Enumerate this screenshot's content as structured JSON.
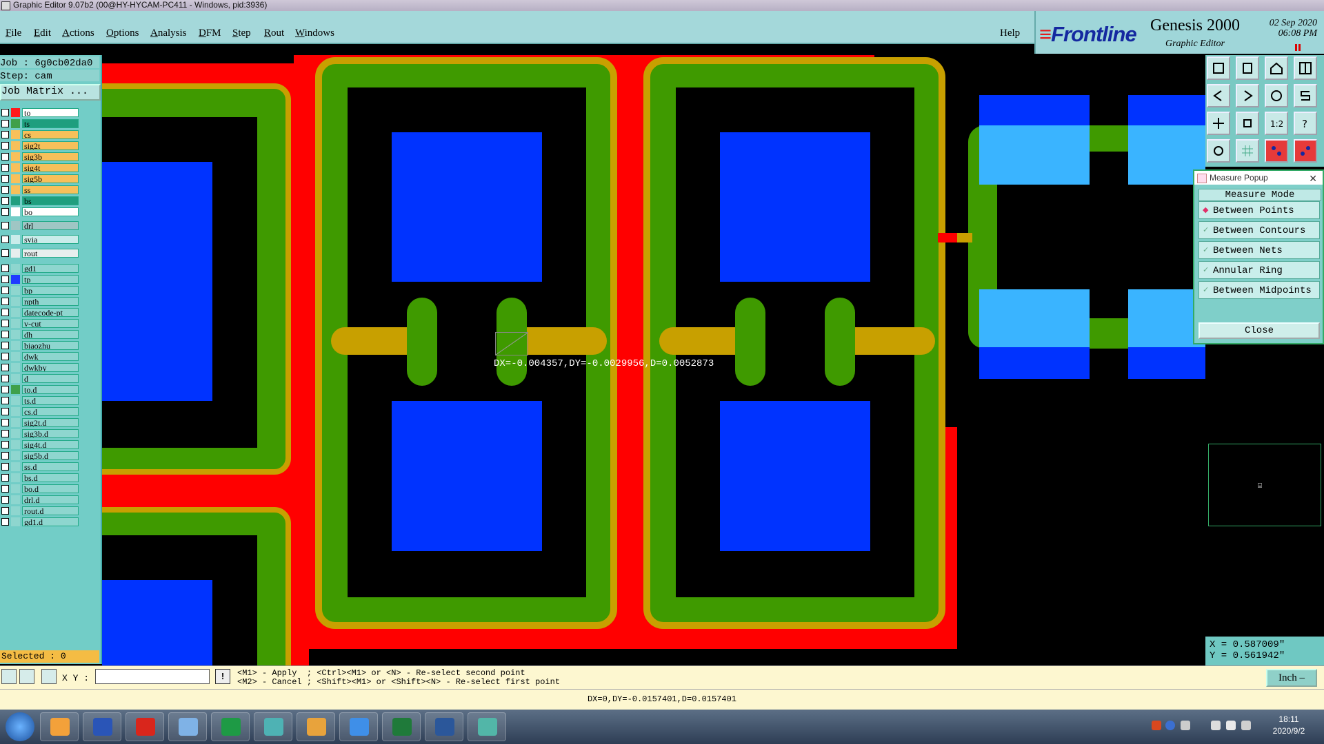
{
  "window": {
    "title": "Graphic Editor 9.07b2 (00@HY-HYCAM-PC411 - Windows, pid:3936)"
  },
  "menu": {
    "items": [
      "File",
      "Edit",
      "Actions",
      "Options",
      "Analysis",
      "DFM",
      "Step",
      "Rout",
      "Windows"
    ],
    "help": "Help"
  },
  "brand": {
    "logo": "Frontline",
    "product": "Genesis 2000",
    "subtitle": "Graphic Editor",
    "date": "02  Sep  2020",
    "time": "06:08  PM"
  },
  "job": {
    "job_label": "Job : 6g0cb02da0",
    "step_label": "Step: cam",
    "matrix_button": "Job Matrix ..."
  },
  "layers": [
    {
      "name": "to",
      "color": "#ff1a1a",
      "bg": "#ffffff"
    },
    {
      "name": "ts",
      "color": "#3fa04a",
      "bg": "#1f9e7e"
    },
    {
      "name": "cs",
      "color": "#f7c05a",
      "bg": "#f7c05a"
    },
    {
      "name": "sig2t",
      "color": "#f7c05a",
      "bg": "#f7c05a"
    },
    {
      "name": "sig3b",
      "color": "#f7c05a",
      "bg": "#f7c05a"
    },
    {
      "name": "sig4t",
      "color": "#f7c05a",
      "bg": "#f7c05a"
    },
    {
      "name": "sig5b",
      "color": "#f7c05a",
      "bg": "#f7c05a"
    },
    {
      "name": "ss",
      "color": "#f7c05a",
      "bg": "#f7c05a"
    },
    {
      "name": "bs",
      "color": "#1f9e7e",
      "bg": "#1f9e7e"
    },
    {
      "name": "bo",
      "color": "#ffffff",
      "bg": "#ffffff"
    },
    {
      "name": "drl",
      "color": "#9fc6c4",
      "bg": "#9fc6c4"
    },
    {
      "name": "svia",
      "color": "#c9ecea",
      "bg": "#c9ecea"
    },
    {
      "name": "rout",
      "color": "#e7eeee",
      "bg": "#e7eeee"
    },
    {
      "name": "gd1",
      "color": "#8ed6cf",
      "bg": "#8ed6cf"
    },
    {
      "name": "tp",
      "color": "#1f3bff",
      "bg": "#8ed6cf"
    },
    {
      "name": "bp",
      "color": "#8ed6cf",
      "bg": "#8ed6cf"
    },
    {
      "name": "npth",
      "color": "#8ed6cf",
      "bg": "#8ed6cf"
    },
    {
      "name": "datecode-pt",
      "color": "#8ed6cf",
      "bg": "#8ed6cf"
    },
    {
      "name": "v-cut",
      "color": "#8ed6cf",
      "bg": "#8ed6cf"
    },
    {
      "name": "dh",
      "color": "#8ed6cf",
      "bg": "#8ed6cf"
    },
    {
      "name": "biaozhu",
      "color": "#8ed6cf",
      "bg": "#8ed6cf"
    },
    {
      "name": "dwk",
      "color": "#8ed6cf",
      "bg": "#8ed6cf"
    },
    {
      "name": "dwkby",
      "color": "#8ed6cf",
      "bg": "#8ed6cf"
    },
    {
      "name": "d",
      "color": "#8ed6cf",
      "bg": "#8ed6cf"
    },
    {
      "name": "to.d",
      "color": "#3fa04a",
      "bg": "#8ed6cf"
    },
    {
      "name": "ts.d",
      "color": "#8ed6cf",
      "bg": "#8ed6cf"
    },
    {
      "name": "cs.d",
      "color": "#8ed6cf",
      "bg": "#8ed6cf"
    },
    {
      "name": "sig2t.d",
      "color": "#8ed6cf",
      "bg": "#8ed6cf"
    },
    {
      "name": "sig3b.d",
      "color": "#8ed6cf",
      "bg": "#8ed6cf"
    },
    {
      "name": "sig4t.d",
      "color": "#8ed6cf",
      "bg": "#8ed6cf"
    },
    {
      "name": "sig5b.d",
      "color": "#8ed6cf",
      "bg": "#8ed6cf"
    },
    {
      "name": "ss.d",
      "color": "#8ed6cf",
      "bg": "#8ed6cf"
    },
    {
      "name": "bs.d",
      "color": "#8ed6cf",
      "bg": "#8ed6cf"
    },
    {
      "name": "bo.d",
      "color": "#8ed6cf",
      "bg": "#8ed6cf"
    },
    {
      "name": "drl.d",
      "color": "#8ed6cf",
      "bg": "#8ed6cf"
    },
    {
      "name": "rout.d",
      "color": "#8ed6cf",
      "bg": "#8ed6cf"
    },
    {
      "name": "gd1.d",
      "color": "#8ed6cf",
      "bg": "#8ed6cf"
    }
  ],
  "selected": "Selected : 0",
  "measure": {
    "readout": "DX=-0.004357,DY=-0.0029956,D=0.0052873",
    "popup_title": "Measure Popup",
    "mode_label": "Measure Mode",
    "options": [
      "Between Points",
      "Between Contours",
      "Between Nets",
      "Annular Ring",
      "Between Midpoints"
    ],
    "selected_option": "Between Points",
    "close_label": "Close"
  },
  "coords": {
    "x": "X = 0.587009\"",
    "y": "Y = 0.561942\""
  },
  "bottom": {
    "xy_label": "X Y :",
    "xy_value": "",
    "excl": "!",
    "hint1": "<M1> - Apply  ; <Ctrl><M1> or <N> - Re-select second point",
    "hint2": "<M2> - Cancel ; <Shift><M1> or <Shift><N> - Re-select first point",
    "units": "Inch",
    "status": "DX=0,DY=-0.0157401,D=0.0157401"
  },
  "taskbar": {
    "time": "18:11",
    "date": "2020/9/2"
  },
  "colors": {
    "red": "#ff0000",
    "green": "#3f9a00",
    "gold": "#c8a000",
    "blue": "#0033ff",
    "light_blue": "#3ab4ff",
    "teal": "#72cdc7"
  }
}
